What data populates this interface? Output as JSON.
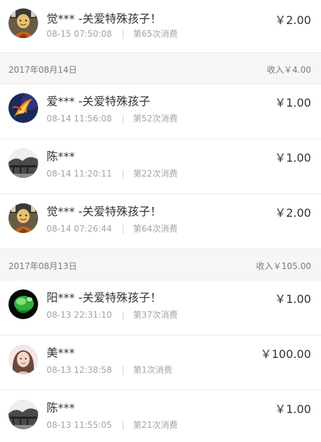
{
  "rows_0": {
    "name": "觉*** -关爱特殊孩子！",
    "time": "08-15 07:50:08",
    "count": "第65次消费",
    "amount": "￥2.00",
    "avatar": "monk-avatar"
  },
  "group_1": {
    "date": "2017年08月14日",
    "income": "收入￥4.00"
  },
  "rows_1": [
    {
      "name": "爱*** -关爱特殊孩子",
      "time": "08-14 11:56:08",
      "count": "第52次消费",
      "amount": "￥1.00",
      "avatar": "phoenix-avatar"
    },
    {
      "name": "陈***",
      "time": "08-14 11:20:11",
      "count": "第22次消费",
      "amount": "￥1.00",
      "avatar": "landscape-avatar"
    },
    {
      "name": "觉*** -关爱特殊孩子！",
      "time": "08-14 07:26:44",
      "count": "第64次消费",
      "amount": "￥2.00",
      "avatar": "monk-avatar"
    }
  ],
  "group_2": {
    "date": "2017年08月13日",
    "income": "收入￥105.00"
  },
  "rows_2": [
    {
      "name": "阳*** -关爱特殊孩子！",
      "time": "08-13 22:31:10",
      "count": "第37次消费",
      "amount": "￥1.00",
      "avatar": "green-jade-avatar"
    },
    {
      "name": "美***",
      "time": "08-13 12:38:58",
      "count": "第1次消费",
      "amount": "￥100.00",
      "avatar": "woman-avatar"
    },
    {
      "name": "陈***",
      "time": "08-13 11:55:05",
      "count": "第21次消费",
      "amount": "￥1.00",
      "avatar": "landscape-avatar"
    }
  ]
}
